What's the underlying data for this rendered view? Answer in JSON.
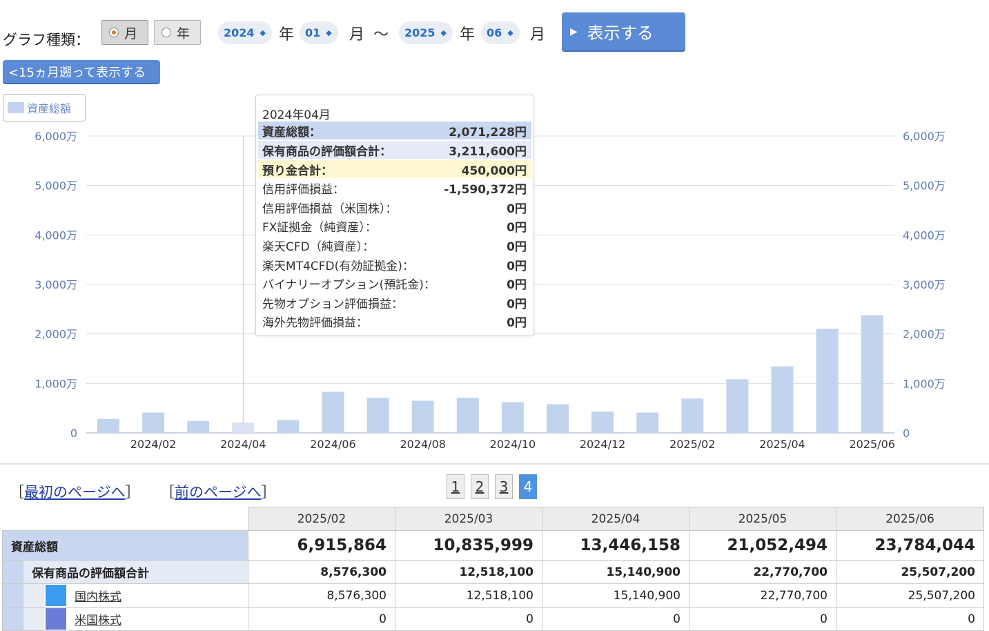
{
  "controls": {
    "graph_type_label": "グラフ種類：",
    "radio_month": "月",
    "radio_year": "年",
    "from_year": "2024",
    "from_month": "01",
    "to_year": "2025",
    "to_month": "06",
    "unit_year": "年",
    "unit_month": "月",
    "tilde": "〜",
    "display_button": "表示する",
    "back_button": "<15ヵ月遡って表示する"
  },
  "legend": {
    "label": "資産総額"
  },
  "tooltip": {
    "title": "2024年04月",
    "rows": [
      {
        "label": "資産総額：",
        "value": "2,071,228円"
      },
      {
        "label": "保有商品の評価額合計：",
        "value": "3,211,600円"
      },
      {
        "label": "預り金合計：",
        "value": "450,000円"
      },
      {
        "label": "信用評価損益：",
        "value": "-1,590,372円"
      },
      {
        "label": "信用評価損益（米国株）：",
        "value": "0円"
      },
      {
        "label": "FX証拠金（純資産）：",
        "value": "0円"
      },
      {
        "label": "楽天CFD（純資産）：",
        "value": "0円"
      },
      {
        "label": "楽天MT4CFD(有効証拠金)：",
        "value": "0円"
      },
      {
        "label": "バイナリーオプション(預託金)：",
        "value": "0円"
      },
      {
        "label": "先物オプション評価損益：",
        "value": "0円"
      },
      {
        "label": "海外先物評価損益：",
        "value": "0円"
      }
    ]
  },
  "colors": {
    "bar": "#c2d3ee",
    "accent": "#5b8ad6",
    "tooltip_total_bg": "#c8d6ef",
    "tooltip_sub_bg": "#e4ebf6",
    "tooltip_deposit_bg": "#fdf8d2",
    "domestic_stock": "#3a9df0",
    "us_stock": "#6d7bd8"
  },
  "chart_data": {
    "type": "bar",
    "x": [
      "2024/01",
      "2024/02",
      "2024/03",
      "2024/04",
      "2024/05",
      "2024/06",
      "2024/07",
      "2024/08",
      "2024/09",
      "2024/10",
      "2024/11",
      "2024/12",
      "2025/01",
      "2025/02",
      "2025/03",
      "2025/04",
      "2025/05",
      "2025/06"
    ],
    "x_tick_labels": [
      "2024/02",
      "2024/04",
      "2024/06",
      "2024/08",
      "2024/10",
      "2024/12",
      "2025/02",
      "2025/04",
      "2025/06"
    ],
    "series": [
      {
        "name": "資産総額",
        "values": [
          2800000,
          4100000,
          2400000,
          2071228,
          2600000,
          8300000,
          7100000,
          6500000,
          7100000,
          6200000,
          5800000,
          4300000,
          4100000,
          6915864,
          10835999,
          13446158,
          21052494,
          23784044
        ]
      }
    ],
    "y_tick_labels": [
      "0",
      "1,000万",
      "2,000万",
      "3,000万",
      "4,000万",
      "5,000万",
      "6,000万"
    ],
    "ylim": [
      0,
      60000000
    ],
    "grid": true,
    "highlighted": "2024/04"
  },
  "pager": {
    "first_bracket_open": "［",
    "first": "最初のページへ",
    "first_bracket_close": "］",
    "prev_bracket_open": "［",
    "prev": "前のページへ",
    "prev_bracket_close": "］",
    "pages": [
      "1",
      "2",
      "3",
      "4"
    ],
    "current": "4"
  },
  "table": {
    "columns": [
      "2025/02",
      "2025/03",
      "2025/04",
      "2025/05",
      "2025/06"
    ],
    "rows": [
      {
        "label": "資産総額",
        "values": [
          "6,915,864",
          "10,835,999",
          "13,446,158",
          "21,052,494",
          "23,784,044"
        ]
      },
      {
        "label": "保有商品の評価額合計",
        "values": [
          "8,576,300",
          "12,518,100",
          "15,140,900",
          "22,770,700",
          "25,507,200"
        ]
      },
      {
        "label": "国内株式",
        "values": [
          "8,576,300",
          "12,518,100",
          "15,140,900",
          "22,770,700",
          "25,507,200"
        ]
      },
      {
        "label": "米国株式",
        "values": [
          "0",
          "0",
          "0",
          "0",
          "0"
        ]
      }
    ]
  }
}
